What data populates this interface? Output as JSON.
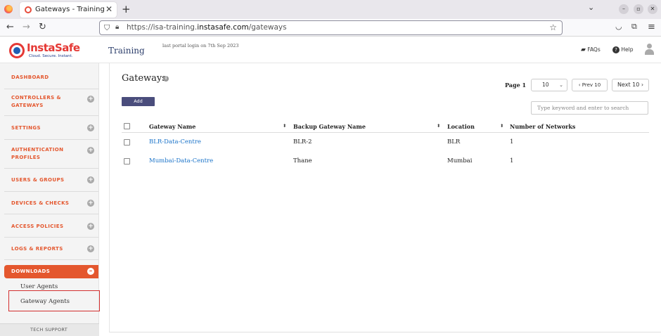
{
  "browser": {
    "tab_title": "Gateways - Training | Inst",
    "tab_close": "✕",
    "new_tab": "+",
    "list_tabs": "⌄",
    "url_prefix": "https://isa-training.",
    "url_domain": "instasafe.com",
    "url_path": "/gateways",
    "window_controls": [
      "–",
      "▫",
      "✕"
    ]
  },
  "header": {
    "logo_text": "InstaSafe",
    "logo_tagline": "Cloud. Secure. Instant.",
    "brand_subtitle": "Training",
    "last_login": "last portal login on 7th Sep 2023",
    "faqs_label": "FAQs",
    "help_label": "Help"
  },
  "sidebar": {
    "items": [
      {
        "label": "DASHBOARD",
        "has_plus": false
      },
      {
        "label": "CONTROLLERS & GATEWAYS",
        "has_plus": true
      },
      {
        "label": "SETTINGS",
        "has_plus": true
      },
      {
        "label": "AUTHENTICATION PROFILES",
        "has_plus": true
      },
      {
        "label": "USERS & GROUPS",
        "has_plus": true
      },
      {
        "label": "DEVICES & CHECKS",
        "has_plus": true
      },
      {
        "label": "ACCESS POLICIES",
        "has_plus": true
      },
      {
        "label": "LOGS & REPORTS",
        "has_plus": true
      },
      {
        "label": "DOWNLOADS",
        "active": true,
        "expanded": true
      }
    ],
    "plus_symbol": "+",
    "minus_symbol": "–",
    "downloads_sub": [
      "User Agents",
      "Gateway Agents"
    ],
    "tech_support": "TECH SUPPORT"
  },
  "main": {
    "title": "Gateways",
    "info_symbol": "i",
    "add_label": "Add",
    "page_label": "Page 1",
    "page_size": "10",
    "prev_label": "‹ Prev 10",
    "next_label": "Next 10 ›",
    "search_placeholder": "Type keyword and enter to search",
    "sort_symbol": "⬍",
    "table": {
      "headers": [
        "Gateway Name",
        "Backup Gateway Name",
        "Location",
        "Number of Networks"
      ],
      "rows": [
        [
          "BLR-Data-Centre",
          "BLR-2",
          "BLR",
          "1"
        ],
        [
          "Mumbai-Data-Centre",
          "Thane",
          "Mumbai",
          "1"
        ]
      ]
    }
  },
  "colors": {
    "accent": "#e4572e",
    "add_button": "#4a4d7c",
    "link": "#1a73c9",
    "highlight_box": "#d32f2f"
  },
  "icons": [
    "firefox-icon",
    "back-icon",
    "forward-icon",
    "reload-icon",
    "shield-icon",
    "lock-icon",
    "star-icon",
    "pocket-icon",
    "extensions-icon",
    "menu-icon",
    "faq-icon",
    "help-icon",
    "avatar-icon",
    "info-icon",
    "plus-icon",
    "minus-icon",
    "sort-icon"
  ]
}
